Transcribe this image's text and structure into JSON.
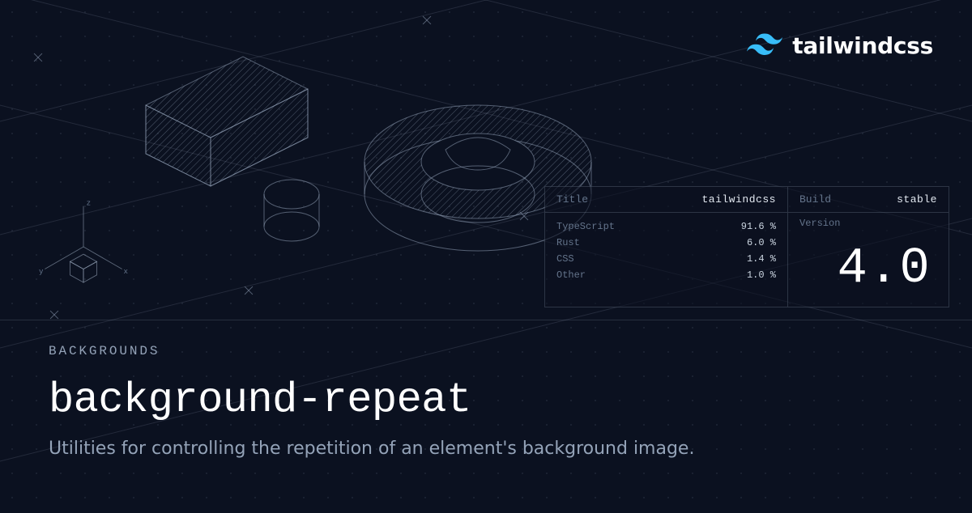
{
  "brand": {
    "name": "tailwindcss"
  },
  "axis": {
    "x": "x",
    "y": "y",
    "z": "z"
  },
  "panel": {
    "title_label": "Title",
    "title_value": "tailwindcss",
    "build_label": "Build",
    "build_value": "stable",
    "version_label": "Version",
    "version_value": "4.0",
    "languages": [
      {
        "name": "TypeScript",
        "pct": "91.6 %"
      },
      {
        "name": "Rust",
        "pct": "6.0 %"
      },
      {
        "name": "CSS",
        "pct": "1.4 %"
      },
      {
        "name": "Other",
        "pct": "1.0 %"
      }
    ]
  },
  "page": {
    "category": "BACKGROUNDS",
    "title": "background-repeat",
    "description": "Utilities for controlling the repetition of an element's background image."
  }
}
